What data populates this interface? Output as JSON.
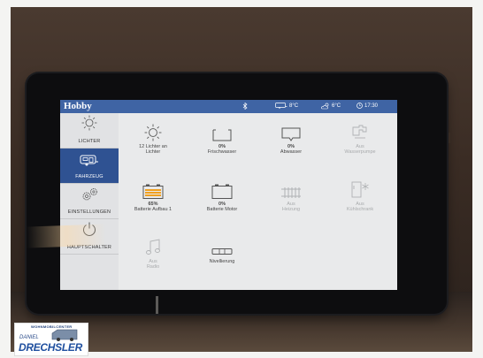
{
  "header": {
    "brand": "Hobby",
    "bluetooth_icon": "bluetooth-icon",
    "inside_temp": "8°C",
    "outside_temp": "6°C",
    "time": "17:30"
  },
  "sidebar": {
    "items": [
      {
        "label": "LICHTER",
        "icon": "sun-icon",
        "active": false
      },
      {
        "label": "FAHRZEUG",
        "icon": "caravan-icon",
        "active": true
      },
      {
        "label": "EINSTELLUNGEN",
        "icon": "gears-icon",
        "active": false
      },
      {
        "label": "HAUPTSCHALTER",
        "icon": "power-icon",
        "active": false
      }
    ]
  },
  "tiles": [
    {
      "line1": "12 Lichter an",
      "line2": "Lichter",
      "icon": "sun-icon",
      "dim": false
    },
    {
      "line1": "0%",
      "line2": "Frischwasser",
      "icon": "tank-icon",
      "dim": false
    },
    {
      "line1": "0%",
      "line2": "Abwasser",
      "icon": "tank-icon",
      "dim": false
    },
    {
      "line1": "Aus",
      "line2": "Wasserpumpe",
      "icon": "tap-icon",
      "dim": true
    },
    {
      "line1": "65%",
      "line2": "Batterie Aufbau 1",
      "icon": "battery-icon",
      "dim": false
    },
    {
      "line1": "0%",
      "line2": "Batterie Motor",
      "icon": "battery-icon",
      "dim": false
    },
    {
      "line1": "Aus",
      "line2": "Heizung",
      "icon": "heater-icon",
      "dim": true
    },
    {
      "line1": "Aus",
      "line2": "Kühlschrank",
      "icon": "fridge-icon",
      "dim": true
    },
    {
      "line1": "Aus",
      "line2": "Radio",
      "icon": "music-icon",
      "dim": true
    },
    {
      "line1": "",
      "line2": "Nivellierung",
      "icon": "level-icon",
      "dim": false
    }
  ],
  "logo": {
    "top": "WOHNMOBILCENTER",
    "name": "DANIEL",
    "brand": "DRECHSLER"
  },
  "colors": {
    "topbar": "#3f64a4",
    "active": "#2f5292",
    "battery_fill": "#f0a020"
  }
}
